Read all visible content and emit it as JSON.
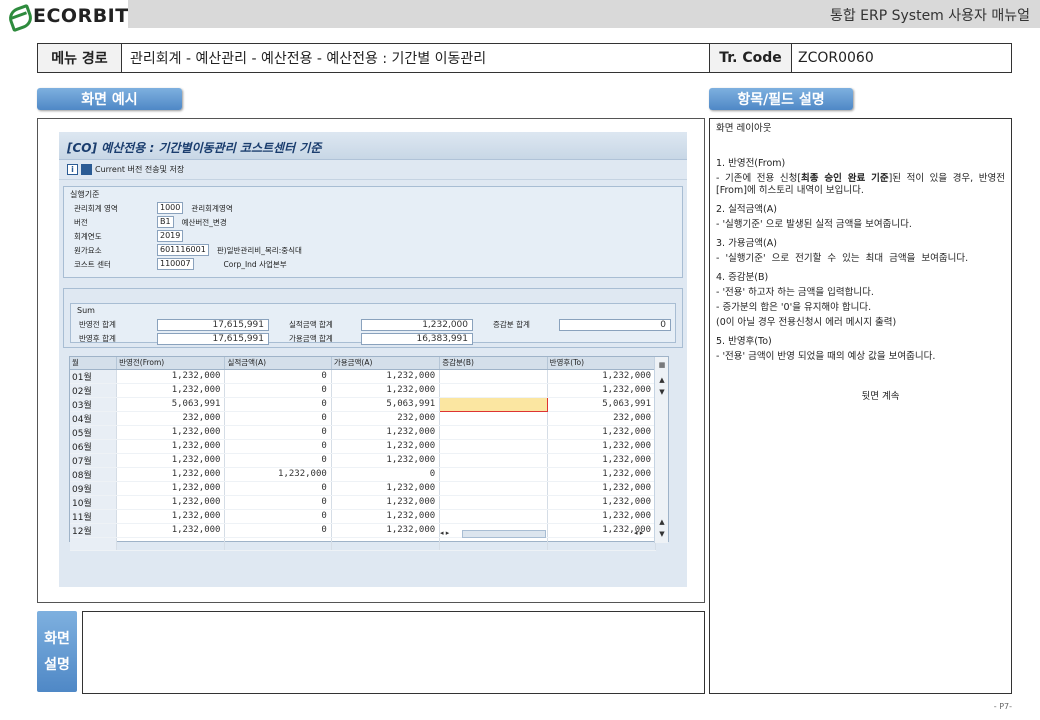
{
  "header": {
    "logo": "ECORBIT",
    "title": "통합 ERP System 사용자 매뉴얼"
  },
  "pathbar": {
    "menu_label": "메뉴 경로",
    "menu_path": "관리회계 - 예산관리 - 예산전용 - 예산전용 : 기간별 이동관리",
    "tr_label": "Tr. Code",
    "tr_code": "ZCOR0060"
  },
  "sections": {
    "example": "화면 예시",
    "fields": "항목/필드 설명",
    "screen_desc_1": "화면",
    "screen_desc_2": "설명"
  },
  "sap": {
    "title": "[CO] 예산전용 : 기간별이동관리 코스트센터 기준",
    "toolbar_text": "Current 버전 전송및 저장",
    "criteria_title": "실행기준",
    "fields": [
      {
        "label": "관리회계 영역",
        "value": "1000",
        "desc": "관리회계영역"
      },
      {
        "label": "버전",
        "value": "B1",
        "desc": "예산버전_변경"
      },
      {
        "label": "회계연도",
        "value": "2019",
        "desc": ""
      },
      {
        "label": "원가요소",
        "value": "601116001",
        "desc": "판)일반관리비_복리:중식대"
      },
      {
        "label": "코스트 센터",
        "value": "110007",
        "desc": "Corp_Ind 사업본부"
      }
    ],
    "sum": {
      "title": "Sum",
      "before_label": "반영전 합계",
      "before_value": "17,615,991",
      "actual_label": "실적금액 합계",
      "actual_value": "1,232,000",
      "change_label": "증감분 합계",
      "change_value": "0",
      "after_label": "반영후 합계",
      "after_value": "17,615,991",
      "available_label": "가용금액 합계",
      "available_value": "16,383,991"
    },
    "grid": {
      "headers": [
        "월",
        "반영전(From)",
        "실적금액(A)",
        "가용금액(A)",
        "증감분(B)",
        "반영후(To)"
      ],
      "rows": [
        [
          "01월",
          "1,232,000",
          "0",
          "1,232,000",
          "",
          "1,232,000"
        ],
        [
          "02월",
          "1,232,000",
          "0",
          "1,232,000",
          "",
          "1,232,000"
        ],
        [
          "03월",
          "5,063,991",
          "0",
          "5,063,991",
          "",
          "5,063,991"
        ],
        [
          "04월",
          "232,000",
          "0",
          "232,000",
          "",
          "232,000"
        ],
        [
          "05월",
          "1,232,000",
          "0",
          "1,232,000",
          "",
          "1,232,000"
        ],
        [
          "06월",
          "1,232,000",
          "0",
          "1,232,000",
          "",
          "1,232,000"
        ],
        [
          "07월",
          "1,232,000",
          "0",
          "1,232,000",
          "",
          "1,232,000"
        ],
        [
          "08월",
          "1,232,000",
          "1,232,000",
          "0",
          "",
          "1,232,000"
        ],
        [
          "09월",
          "1,232,000",
          "0",
          "1,232,000",
          "",
          "1,232,000"
        ],
        [
          "10월",
          "1,232,000",
          "0",
          "1,232,000",
          "",
          "1,232,000"
        ],
        [
          "11월",
          "1,232,000",
          "0",
          "1,232,000",
          "",
          "1,232,000"
        ],
        [
          "12월",
          "1,232,000",
          "0",
          "1,232,000",
          "",
          "1,232,000"
        ]
      ]
    }
  },
  "description": {
    "layout_title": "화면 레이아웃",
    "item1_title": "1.    반영전(From)",
    "item1_text_a": "  - 기존에 전용 신청[",
    "item1_text_bold": "최종 승인 완료 기준",
    "item1_text_b": "]된 적이 있을 경우, 반영전[From]에 히스토리 내역이 보입니다.",
    "item2_title": "2.  실적금액(A)",
    "item2_text": "  - '실행기준' 으로 발생된 실적 금액을 보여줍니다.",
    "item3_title": "3.  가용금액(A)",
    "item3_text": "  - '실행기준' 으로 전기할 수 있는 최대 금액을 보여줍니다.",
    "item4_title": "4.  증감분(B)",
    "item4_text_1": "  - '전용' 하고자 하는 금액을 입력합니다.",
    "item4_text_2": "  - 증가분의 합은 '0'을 유지해야 합니다.",
    "item4_text_3": "   (0이 아닐 경우 전용신청시 에러 메시지 출력)",
    "item5_title": "5.  반영후(To)",
    "item5_text": "  - '전용' 금액이 반영 되었을 때의 예상 값을 보여줍니다.",
    "continue": "뒷면 계속"
  },
  "page_number": "- P7-"
}
